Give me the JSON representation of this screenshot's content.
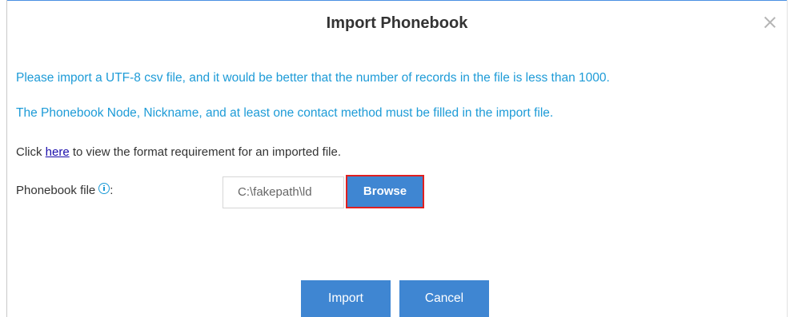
{
  "dialog": {
    "title": "Import Phonebook",
    "close_icon": "close-icon"
  },
  "notes": {
    "line1": "Please import a UTF-8 csv file, and it would be better that the number of records in the file is less than 1000.",
    "line2": "The Phonebook Node, Nickname, and at least one contact method must be filled in the import file."
  },
  "format": {
    "prefix": "Click ",
    "link": "here",
    "suffix": " to view the format requirement for an imported file."
  },
  "file_field": {
    "label": "Phonebook file",
    "info_icon": "info-icon",
    "colon": ":",
    "value": "C:\\fakepath\\ld",
    "browse_label": "Browse"
  },
  "actions": {
    "import_label": "Import",
    "cancel_label": "Cancel"
  },
  "colors": {
    "accent": "#3f86d2",
    "note_text": "#1d9bd7",
    "highlight_border": "#e02020",
    "link": "#1a0dab"
  }
}
